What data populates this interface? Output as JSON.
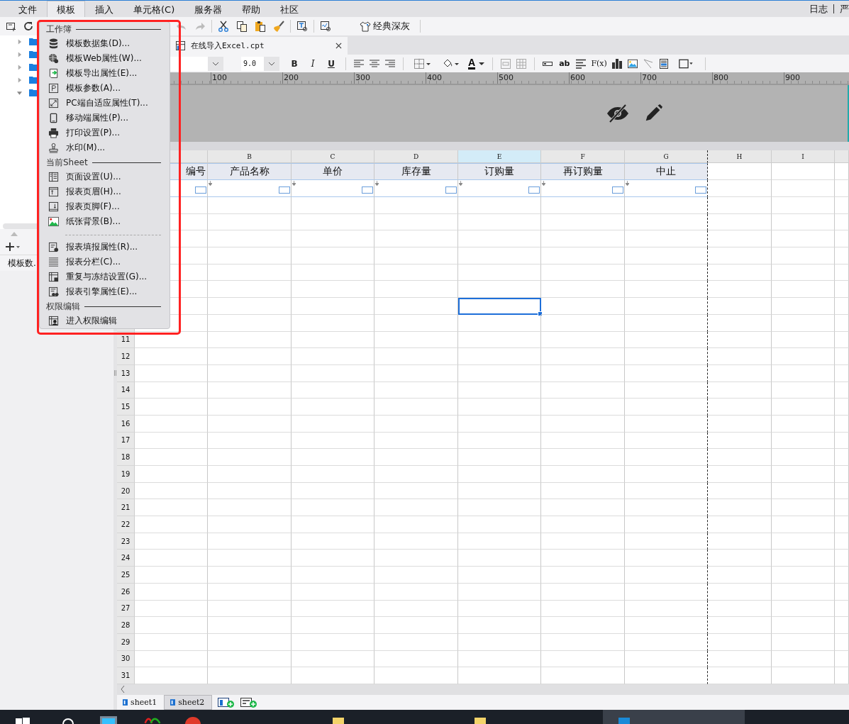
{
  "menubar": {
    "items": [
      {
        "label": "文件",
        "selected": false
      },
      {
        "label": "模板",
        "selected": true
      },
      {
        "label": "插入",
        "selected": false
      },
      {
        "label": "单元格(C)",
        "selected": false
      },
      {
        "label": "服务器",
        "selected": false
      },
      {
        "label": "帮助",
        "selected": false
      },
      {
        "label": "社区",
        "selected": false
      }
    ],
    "right_links": [
      "日志",
      "严"
    ]
  },
  "toolbar": {
    "theme_button": "经典深灰"
  },
  "tree": [
    {
      "expanded": false
    },
    {
      "expanded": false
    },
    {
      "expanded": false
    },
    {
      "expanded": false
    },
    {
      "expanded": true
    }
  ],
  "left_tab": "模板数.",
  "file_tab": {
    "label": "在线导入Excel.cpt"
  },
  "format_bar": {
    "font_size": "9.0",
    "style_buttons": [
      "B",
      "I",
      "U"
    ],
    "font_color_button": "A",
    "text_button": "ab",
    "formula_button": "F(x)"
  },
  "ruler": [
    "100",
    "200",
    "300",
    "400",
    "500",
    "600",
    "700",
    "800",
    "900"
  ],
  "columns": [
    {
      "selected": false
    },
    {
      "label": "B",
      "selected": false
    },
    {
      "label": "C",
      "selected": false
    },
    {
      "label": "D",
      "selected": false
    },
    {
      "label": "E",
      "selected": true
    },
    {
      "label": "F",
      "selected": false
    },
    {
      "label": "G",
      "selected": false
    },
    {
      "label": "H",
      "selected": false
    },
    {
      "label": "I",
      "selected": false
    },
    {
      "selected": false
    }
  ],
  "rows": [
    {
      "kind": "header",
      "selected": false,
      "cells": [
        "编号",
        "产品名称",
        "单价",
        "库存量",
        "订购量",
        "再订购量",
        "中止"
      ]
    },
    {
      "kind": "filter",
      "selected": false
    },
    {
      "kind": "blank",
      "selected": false
    },
    {
      "kind": "blank",
      "selected": false
    },
    {
      "kind": "blank",
      "selected": false
    },
    {
      "kind": "blank",
      "selected": false
    },
    {
      "kind": "blank",
      "selected": false
    },
    {
      "kind": "blank",
      "selected": false
    },
    {
      "kind": "blank",
      "selected": true
    },
    {
      "kind": "blank",
      "selected": false
    },
    {
      "kind": "blank",
      "selected": false,
      "number": "11"
    },
    {
      "kind": "blank",
      "selected": false,
      "number": "12"
    },
    {
      "kind": "blank",
      "selected": false,
      "number": "13"
    },
    {
      "kind": "blank",
      "selected": false,
      "number": "14"
    },
    {
      "kind": "blank",
      "selected": false,
      "number": "15"
    },
    {
      "kind": "blank",
      "selected": false,
      "number": "16"
    },
    {
      "kind": "blank",
      "selected": false,
      "number": "17"
    },
    {
      "kind": "blank",
      "selected": false,
      "number": "18"
    },
    {
      "kind": "blank",
      "selected": false,
      "number": "19"
    },
    {
      "kind": "blank",
      "selected": false,
      "number": "20"
    },
    {
      "kind": "blank",
      "selected": false,
      "number": "21"
    },
    {
      "kind": "blank",
      "selected": false,
      "number": "22"
    },
    {
      "kind": "blank",
      "selected": false,
      "number": "23"
    },
    {
      "kind": "blank",
      "selected": false,
      "number": "24"
    },
    {
      "kind": "blank",
      "selected": false,
      "number": "25"
    },
    {
      "kind": "blank",
      "selected": false,
      "number": "26"
    },
    {
      "kind": "blank",
      "selected": false,
      "number": "27"
    },
    {
      "kind": "blank",
      "selected": false,
      "number": "28"
    },
    {
      "kind": "blank",
      "selected": false,
      "number": "29"
    },
    {
      "kind": "blank",
      "selected": false,
      "number": "30"
    },
    {
      "kind": "blank",
      "selected": false,
      "number": "31"
    }
  ],
  "sheet_tabs": [
    {
      "label": "sheet1",
      "selected": true
    },
    {
      "label": "sheet2",
      "selected": false
    }
  ],
  "dropdown_menu": {
    "sections": [
      {
        "title": "工作簿",
        "groups": [
          [
            {
              "label": "模板数据集(D)...",
              "kind": "database"
            },
            {
              "label": "模板Web属性(W)...",
              "kind": "globe"
            },
            {
              "label": "模板导出属性(E)...",
              "kind": "export"
            },
            {
              "label": "模板参数(A)...",
              "kind": "param"
            },
            {
              "label": "PC端自适应属性(T)...",
              "kind": "resize"
            },
            {
              "label": "移动端属性(P)...",
              "kind": "mobile"
            },
            {
              "label": "打印设置(P)...",
              "kind": "printer"
            },
            {
              "label": "水印(M)...",
              "kind": "stamp"
            }
          ]
        ]
      },
      {
        "title": "当前Sheet",
        "groups": [
          [
            {
              "label": "页面设置(U)...",
              "kind": "page"
            },
            {
              "label": "报表页眉(H)...",
              "kind": "header"
            },
            {
              "label": "报表页脚(F)...",
              "kind": "footer"
            },
            {
              "label": "纸张背景(B)...",
              "kind": "image"
            }
          ],
          [
            {
              "label": "报表填报属性(R)...",
              "kind": "form"
            },
            {
              "label": "报表分栏(C)...",
              "kind": "columns"
            },
            {
              "label": "重复与冻结设置(G)...",
              "kind": "freeze"
            },
            {
              "label": "报表引擎属性(E)...",
              "kind": "engine"
            }
          ]
        ]
      },
      {
        "title": "权限编辑",
        "groups": [
          [
            {
              "label": "进入权限编辑",
              "kind": "permission"
            }
          ]
        ]
      }
    ]
  }
}
